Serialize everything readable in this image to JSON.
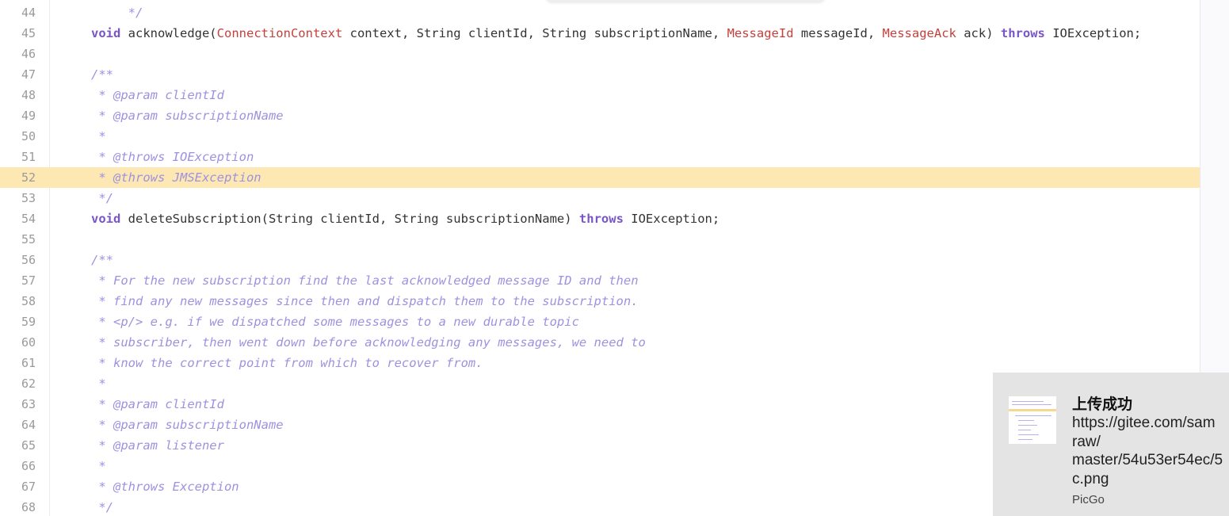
{
  "editor": {
    "active_line": "52",
    "lines": [
      {
        "n": "44",
        "parts": [
          {
            "c": "cm",
            "t": "     */"
          }
        ]
      },
      {
        "n": "45",
        "parts": [
          {
            "c": "kw",
            "t": "void"
          },
          {
            "c": "",
            "t": " acknowledge("
          },
          {
            "c": "ty",
            "t": "ConnectionContext"
          },
          {
            "c": "",
            "t": " context, String clientId, String subscriptionName, "
          },
          {
            "c": "ty",
            "t": "MessageId"
          },
          {
            "c": "",
            "t": " messageId, "
          },
          {
            "c": "ty",
            "t": "MessageAck"
          },
          {
            "c": "",
            "t": " ack) "
          },
          {
            "c": "kw",
            "t": "throws"
          },
          {
            "c": "",
            "t": " IOException;"
          }
        ]
      },
      {
        "n": "46",
        "parts": []
      },
      {
        "n": "47",
        "parts": [
          {
            "c": "cm",
            "t": "/**"
          }
        ]
      },
      {
        "n": "48",
        "parts": [
          {
            "c": "cm",
            "t": " * @param clientId"
          }
        ]
      },
      {
        "n": "49",
        "parts": [
          {
            "c": "cm",
            "t": " * @param subscriptionName"
          }
        ]
      },
      {
        "n": "50",
        "parts": [
          {
            "c": "cm",
            "t": " *"
          }
        ]
      },
      {
        "n": "51",
        "parts": [
          {
            "c": "cm",
            "t": " * @throws IOException"
          }
        ]
      },
      {
        "n": "52",
        "parts": [
          {
            "c": "cm",
            "t": " * @throws JMSException"
          }
        ]
      },
      {
        "n": "53",
        "parts": [
          {
            "c": "cm",
            "t": " */"
          }
        ]
      },
      {
        "n": "54",
        "parts": [
          {
            "c": "kw",
            "t": "void"
          },
          {
            "c": "",
            "t": " deleteSubscription(String clientId, String subscriptionName) "
          },
          {
            "c": "kw",
            "t": "throws"
          },
          {
            "c": "",
            "t": " IOException;"
          }
        ]
      },
      {
        "n": "55",
        "parts": []
      },
      {
        "n": "56",
        "parts": [
          {
            "c": "cm",
            "t": "/**"
          }
        ]
      },
      {
        "n": "57",
        "parts": [
          {
            "c": "cm",
            "t": " * For the new subscription find the last acknowledged message ID and then"
          }
        ]
      },
      {
        "n": "58",
        "parts": [
          {
            "c": "cm",
            "t": " * find any new messages since then and dispatch them to the subscription."
          }
        ]
      },
      {
        "n": "59",
        "parts": [
          {
            "c": "cm",
            "t": " * <p/> e.g. if we dispatched some messages to a new durable topic"
          }
        ]
      },
      {
        "n": "60",
        "parts": [
          {
            "c": "cm",
            "t": " * subscriber, then went down before acknowledging any messages, we need to"
          }
        ]
      },
      {
        "n": "61",
        "parts": [
          {
            "c": "cm",
            "t": " * know the correct point from which to recover from."
          }
        ]
      },
      {
        "n": "62",
        "parts": [
          {
            "c": "cm",
            "t": " *"
          }
        ]
      },
      {
        "n": "63",
        "parts": [
          {
            "c": "cm",
            "t": " * @param clientId"
          }
        ]
      },
      {
        "n": "64",
        "parts": [
          {
            "c": "cm",
            "t": " * @param subscriptionName"
          }
        ]
      },
      {
        "n": "65",
        "parts": [
          {
            "c": "cm",
            "t": " * @param listener"
          }
        ]
      },
      {
        "n": "66",
        "parts": [
          {
            "c": "cm",
            "t": " *"
          }
        ]
      },
      {
        "n": "67",
        "parts": [
          {
            "c": "cm",
            "t": " * @throws Exception"
          }
        ]
      },
      {
        "n": "68",
        "parts": [
          {
            "c": "cm",
            "t": " */"
          }
        ]
      }
    ]
  },
  "toast": {
    "title": "上传成功",
    "message": "https://gitee.com/sam\nraw/\nmaster/54u53er54ec/5\nc.png",
    "app": "PicGo"
  },
  "colors": {
    "keyword": "#7a55c8",
    "type": "#c5403c",
    "comment": "#9d92e0",
    "highlight": "#fde7b3"
  }
}
